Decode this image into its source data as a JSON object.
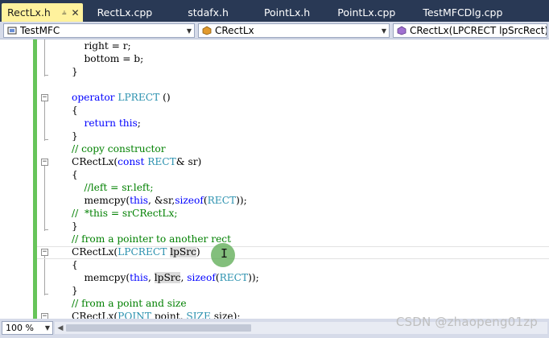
{
  "tabs": [
    {
      "label": "RectLx.h",
      "active": true
    },
    {
      "label": "RectLx.cpp"
    },
    {
      "label": "stdafx.h"
    },
    {
      "label": "PointLx.h"
    },
    {
      "label": "PointLx.cpp"
    },
    {
      "label": "TestMFCDlg.cpp"
    }
  ],
  "tab_icons": {
    "pin": "pin-icon",
    "close": "close-icon"
  },
  "navbar": {
    "project": "TestMFC",
    "class": "CRectLx",
    "member": "CRectLx(LPCRECT lpSrcRect)"
  },
  "code_lines": [
    "        right = r;",
    "        bottom = b;",
    "    }",
    "",
    "    operator LPRECT ()",
    "    {",
    "        return this;",
    "    }",
    "    // copy constructor",
    "    CRectLx(const RECT& sr)",
    "    {",
    "        //left = sr.left;",
    "        memcpy(this, &sr,sizeof(RECT));",
    "    //  *this = srCRectLx;",
    "    }",
    "    // from a pointer to another rect",
    "    CRectLx(LPCRECT lpSrc)",
    "    {",
    "        memcpy(this, lpSrc, sizeof(RECT));",
    "    }",
    "    // from a point and size",
    "    CRectLx(POINT point, SIZE size);"
  ],
  "status": {
    "zoom": "100 %"
  },
  "watermark": "CSDN @zhaopeng01zp",
  "colors": {
    "tabbar": "#293955",
    "active_tab": "#fff29d",
    "keyword": "#0000ff",
    "comment": "#008000",
    "type": "#2b91af",
    "change_bar": "#67c45a"
  }
}
